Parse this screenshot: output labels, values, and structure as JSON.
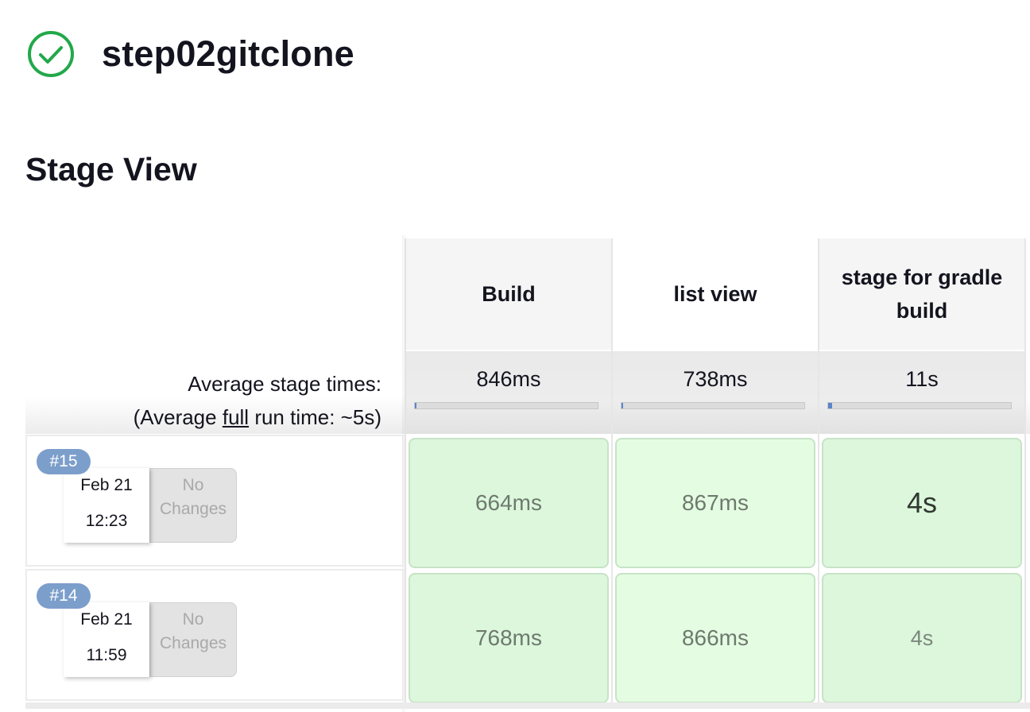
{
  "job": {
    "title": "step02gitclone",
    "status": "success"
  },
  "section_title": "Stage View",
  "stages": [
    {
      "name": "Build",
      "avg": "846ms",
      "avg_fraction": 0.01
    },
    {
      "name": "list view",
      "avg": "738ms",
      "avg_fraction": 0.01
    },
    {
      "name": "stage for gradle build",
      "avg": "11s",
      "avg_fraction": 0.02
    }
  ],
  "averages": {
    "label": "Average stage times:",
    "run_prefix": "(Average ",
    "run_link": "full",
    "run_suffix": " run time: ~5s)"
  },
  "builds": [
    {
      "number": "#15",
      "date": "Feb 21",
      "time": "12:23",
      "changes_line1": "No",
      "changes_line2": "Changes",
      "durations": [
        "664ms",
        "867ms",
        "4s"
      ]
    },
    {
      "number": "#14",
      "date": "Feb 21",
      "time": "11:59",
      "changes_line1": "No",
      "changes_line2": "Changes",
      "durations": [
        "768ms",
        "866ms",
        "4s"
      ]
    }
  ],
  "colors": {
    "success": "#22a84a",
    "badge": "#7c9ecb",
    "cell_green": "#dcf7dc",
    "progress": "#5b85c8"
  },
  "icons": {
    "status": "check-circle-icon"
  }
}
